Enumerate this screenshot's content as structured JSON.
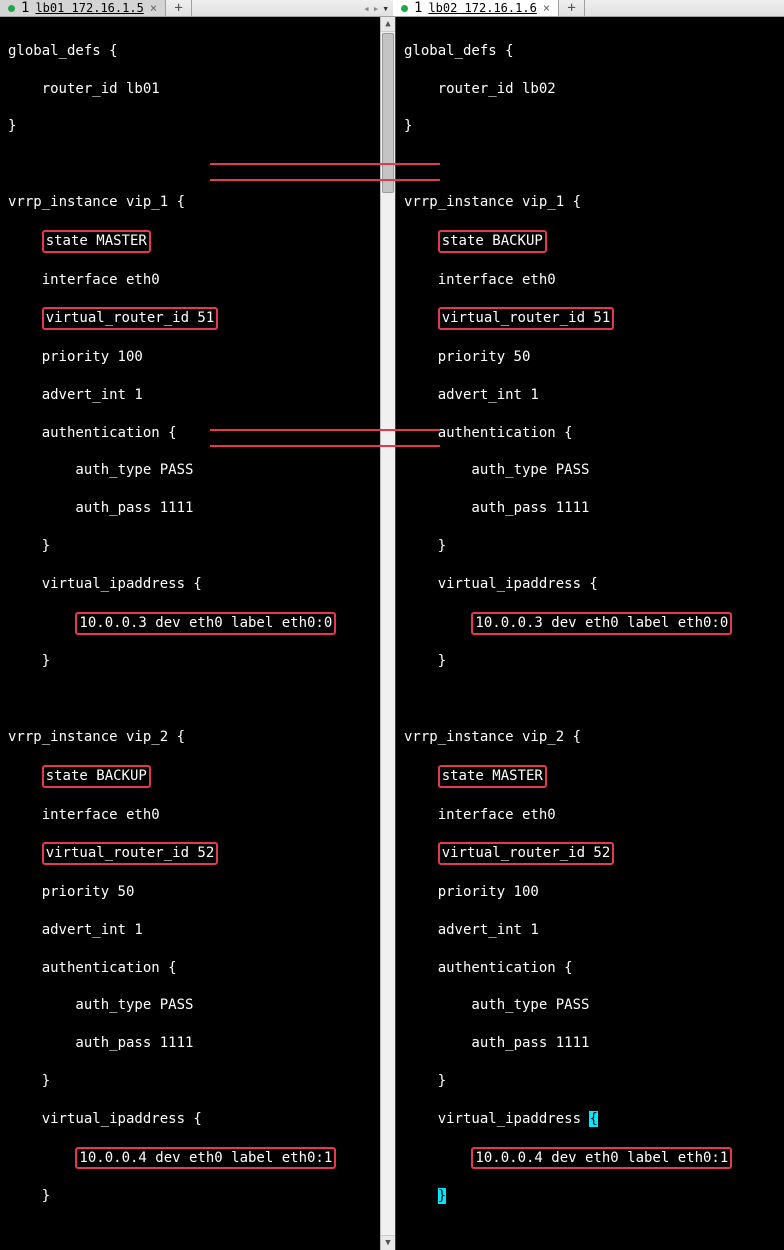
{
  "tabs": {
    "left": {
      "num": "1",
      "label": "lb01 172.16.1.5"
    },
    "right": {
      "num": "1",
      "label": "lb02 172.16.1.6"
    }
  },
  "left": {
    "router_id": "router_id lb01",
    "vip1": {
      "header": "vrrp_instance vip_1 {",
      "state": "state MASTER",
      "iface": "interface eth0",
      "vrid": "virtual_router_id 51",
      "prio": "priority 100",
      "adv": "advert_int 1",
      "auth_open": "authentication {",
      "auth_type": "auth_type PASS",
      "auth_pass": "auth_pass 1111",
      "vip_open": "virtual_ipaddress {",
      "vip_line": "10.0.0.3 dev eth0 label eth0:0"
    },
    "vip2": {
      "header": "vrrp_instance vip_2 {",
      "state": "state BACKUP",
      "iface": "interface eth0",
      "vrid": "virtual_router_id 52",
      "prio": "priority 50",
      "adv": "advert_int 1",
      "auth_open": "authentication {",
      "auth_type": "auth_type PASS",
      "auth_pass": "auth_pass 1111",
      "vip_open": "virtual_ipaddress {",
      "vip_line": "10.0.0.4 dev eth0 label eth0:1"
    }
  },
  "right": {
    "router_id": "router_id lb02",
    "vip1": {
      "header": "vrrp_instance vip_1 {",
      "state": "state BACKUP",
      "iface": "interface eth0",
      "vrid": "virtual_router_id 51",
      "prio": "priority 50",
      "adv": "advert_int 1",
      "auth_open": "authentication {",
      "auth_type": "auth_type PASS",
      "auth_pass": "auth_pass 1111",
      "vip_open": "virtual_ipaddress {",
      "vip_line": "10.0.0.3 dev eth0 label eth0:0"
    },
    "vip2": {
      "header": "vrrp_instance vip_2 {",
      "state": "state MASTER",
      "iface": "interface eth0",
      "vrid": "virtual_router_id 52",
      "prio": "priority 100",
      "adv": "advert_int 1",
      "auth_open": "authentication {",
      "auth_type": "auth_type PASS",
      "auth_pass": "auth_pass 1111",
      "vip_open": "virtual_ipaddress ",
      "vip_line": "10.0.0.4 dev eth0 label eth0:1"
    }
  },
  "common": {
    "global_defs": "global_defs {",
    "brace_close": "}"
  }
}
